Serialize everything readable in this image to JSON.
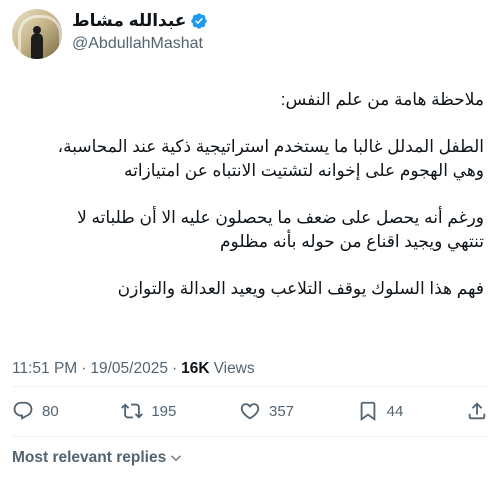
{
  "author": {
    "display_name": "عبدالله مشاط",
    "handle": "@AbdullahMashat"
  },
  "tweet": {
    "paragraphs": [
      "ملاحظة هامة من علم النفس:",
      "الطفل المدلل غالبا ما يستخدم استراتيجية ذكية عند المحاسبة،\nوهي الهجوم على إخوانه لتشتيت الانتباه عن امتيازاته",
      "ورغم أنه يحصل على ضعف ما يحصلون عليه الا أن طلباته لا\nتنتهي ويجيد اقناع من حوله بأنه مظلوم",
      "فهم هذا السلوك يوقف التلاعب ويعيد العدالة والتوازن"
    ]
  },
  "meta": {
    "time": "11:51 PM",
    "separator1": "·",
    "date": "19/05/2025",
    "separator2": "·",
    "views_count": "16K",
    "views_label": "Views"
  },
  "actions": {
    "replies": "80",
    "reposts": "195",
    "likes": "357",
    "bookmarks": "44"
  },
  "replies_sort": {
    "label": "Most relevant replies"
  },
  "icons": [
    "verified-icon",
    "reply-icon",
    "repost-icon",
    "like-icon",
    "bookmark-icon",
    "share-icon",
    "chevron-down-icon"
  ],
  "colors": {
    "verified": "#1d9bf0",
    "text": "#0f1419",
    "secondary": "#536471",
    "divider": "#eff3f4"
  }
}
